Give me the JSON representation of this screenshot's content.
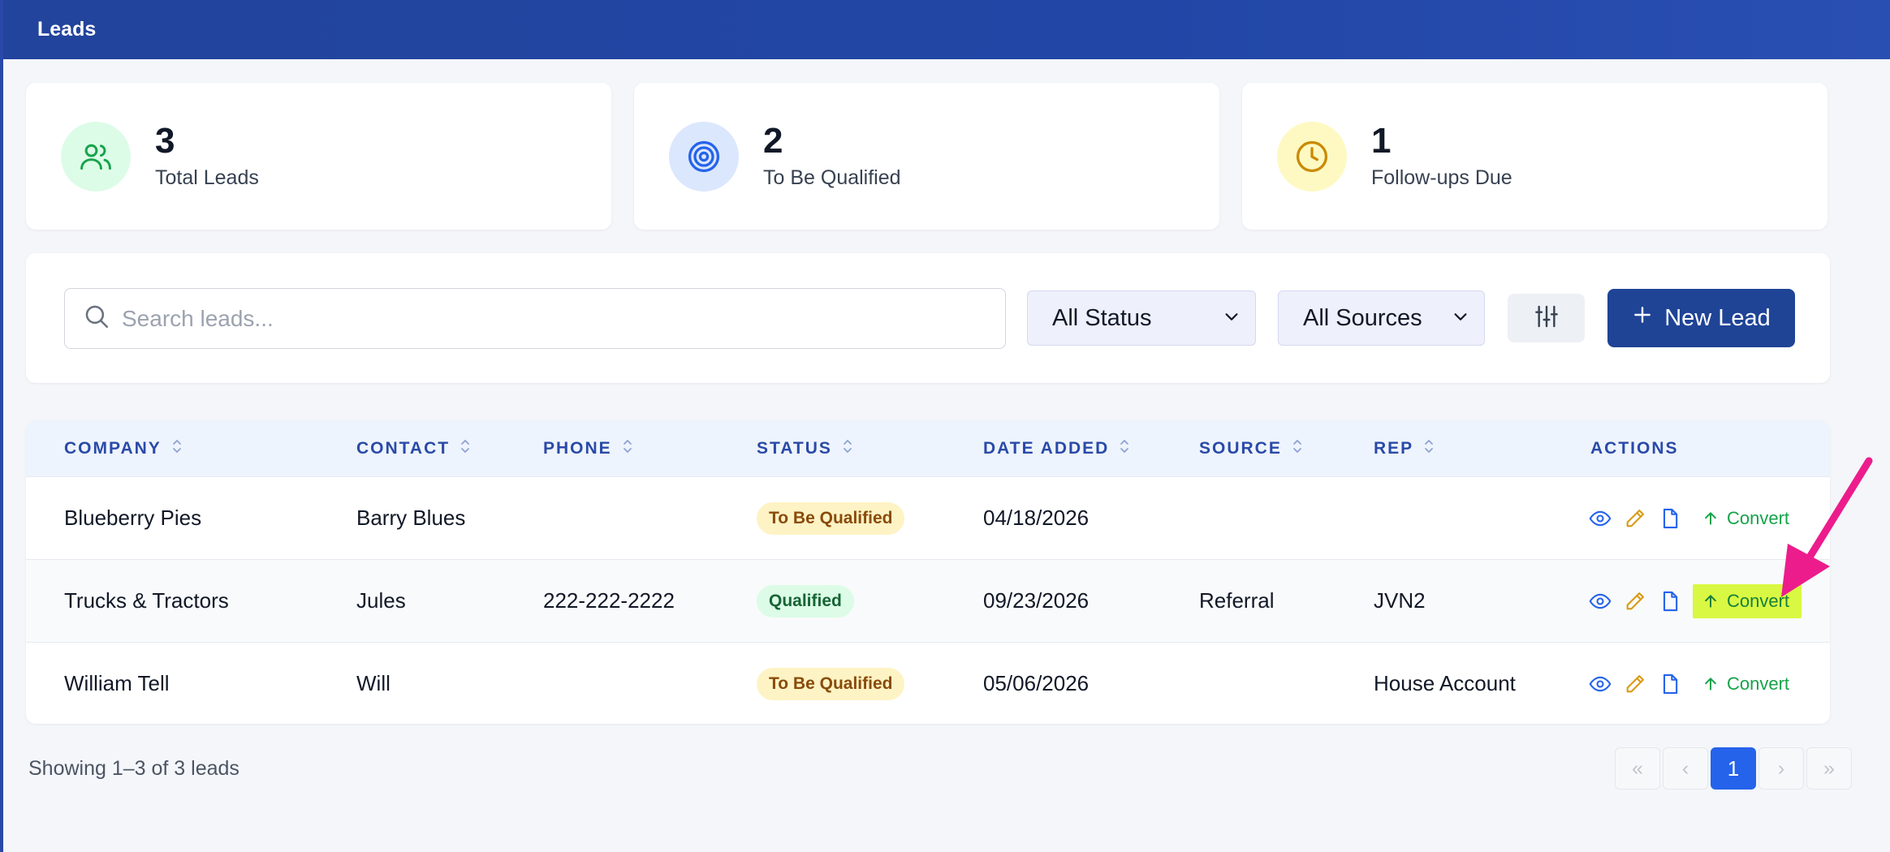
{
  "header": {
    "title": "Leads"
  },
  "stats": [
    {
      "value": "3",
      "label": "Total Leads",
      "icon": "users-icon",
      "color": "#16a34a"
    },
    {
      "value": "2",
      "label": "To Be Qualified",
      "icon": "target-icon",
      "color": "#2563eb"
    },
    {
      "value": "1",
      "label": "Follow-ups Due",
      "icon": "clock-icon",
      "color": "#ca8a04"
    }
  ],
  "filters": {
    "search_placeholder": "Search leads...",
    "status_value": "All Status",
    "sources_value": "All Sources",
    "new_lead_label": "New Lead"
  },
  "table": {
    "columns": [
      "COMPANY",
      "CONTACT",
      "PHONE",
      "STATUS",
      "DATE ADDED",
      "SOURCE",
      "REP",
      "ACTIONS"
    ],
    "rows": [
      {
        "company": "Blueberry Pies",
        "contact": "Barry Blues",
        "phone": "",
        "status": "To Be Qualified",
        "date": "04/18/2026",
        "source": "",
        "rep": "",
        "action": "Convert"
      },
      {
        "company": "Trucks & Tractors",
        "contact": "Jules",
        "phone": "222-222-2222",
        "status": "Qualified",
        "date": "09/23/2026",
        "source": "Referral",
        "rep": "JVN2",
        "action": "Convert"
      },
      {
        "company": "William Tell",
        "contact": "Will",
        "phone": "",
        "status": "To Be Qualified",
        "date": "05/06/2026",
        "source": "",
        "rep": "House Account",
        "action": "Convert"
      }
    ]
  },
  "footer": {
    "showing": "Showing 1–3 of 3 leads",
    "pager": {
      "first": "«",
      "prev": "‹",
      "current": "1",
      "next": "›",
      "last": "»"
    }
  },
  "colors": {
    "accent": "#1f4496",
    "annotation_arrow": "#ec1c8c",
    "highlight": "#d9f843"
  }
}
